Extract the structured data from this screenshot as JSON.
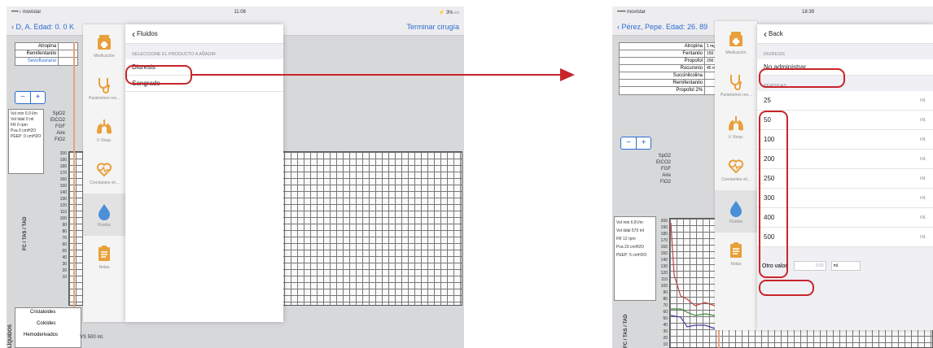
{
  "left": {
    "status": {
      "carrier": "••••○ movistar",
      "time": "11:08",
      "battery": "⚡ 3% ▭"
    },
    "nav": {
      "back_label": "D, A. Edad: 0. 0 K",
      "end_label": "Terminar cirugía"
    },
    "drugs": [
      "Atropina",
      "Remifentanilo",
      "Sevofluorano"
    ],
    "vitals": [
      "Vol min 0.0 l/m",
      "Vol tidal 0 ml",
      "FR 0 rpm",
      "Pva 0 cmH2O",
      "PEEP: 0 cmH2O"
    ],
    "gas_labels": [
      "SpO2",
      "EtCO2",
      "FGF",
      "Aire",
      "FiO2"
    ],
    "scale": [
      "200",
      "190",
      "180",
      "170",
      "160",
      "150",
      "140",
      "130",
      "120",
      "110",
      "100",
      "90",
      "80",
      "70",
      "60",
      "50",
      "40",
      "30",
      "20",
      "10"
    ],
    "axis_label": "FC / TAS / TAD",
    "fluids": [
      "Cristaloides",
      "Coloides",
      "Hemoderivados"
    ],
    "fluids_note": "VS 500 ml.",
    "fluids_side": "LÍQUIDOS",
    "panel": {
      "back_label": "Fluidos",
      "section": "SELECCIONE EL PRODUCTO A AÑADIR",
      "options": [
        "Diuresis",
        "Sangrado"
      ]
    }
  },
  "sidebar": {
    "items": [
      "Medicación",
      "Parámetros res...",
      "V. Resp.",
      "Constantes vit...",
      "Fluidos",
      "Notas"
    ]
  },
  "right": {
    "status": {
      "carrier": "••••• movistar",
      "time": "18:39"
    },
    "nav": {
      "back_label": "Pérez, Pepe. Edad: 26. 89"
    },
    "drugs": [
      {
        "name": "Atropina",
        "dose": "1 mgr."
      },
      {
        "name": "Fentanilo",
        "dose": "150 µgr."
      },
      {
        "name": "Propofol",
        "dose": "200 mgr."
      },
      {
        "name": "Rocuronio",
        "dose": "45 mgr."
      },
      {
        "name": "Succinilcolina",
        "dose": ""
      },
      {
        "name": "Remifentanilo",
        "dose": ""
      },
      {
        "name": "Propofol 2%",
        "dose": ""
      }
    ],
    "gas_labels": [
      "SpO2",
      "EtCO2",
      "FGF",
      "Aire",
      "FiO2"
    ],
    "vitals": [
      "Vol min 6.8 l/m",
      "Vol tidal 570 ml",
      "FR 12 rpm",
      "Pva 23 cmH2O",
      "PEEP: 5 cmH2O"
    ],
    "scale": [
      "200",
      "190",
      "180",
      "170",
      "160",
      "150",
      "140",
      "130",
      "120",
      "110",
      "100",
      "90",
      "80",
      "70",
      "60",
      "50",
      "40",
      "30",
      "20",
      "10"
    ],
    "axis_label": "FC / TAS / TAD",
    "panel": {
      "back_label": "Back",
      "diuresis_head": "DIURESIS",
      "diuresis_value": "No administrar",
      "perdidas_head": "PÉRDIDAS",
      "amounts": [
        "25",
        "50",
        "100",
        "200",
        "250",
        "300",
        "400",
        "500"
      ],
      "unit": "ml.",
      "otro_label": "Otro valor:",
      "otro_placeholder": "0.00",
      "otro_unit": "ml."
    }
  },
  "colors": {
    "accent": "#2d6bd1",
    "highlight": "#c8252a",
    "icon_orange": "#e8a03a",
    "icon_blue": "#4a8fd8"
  }
}
